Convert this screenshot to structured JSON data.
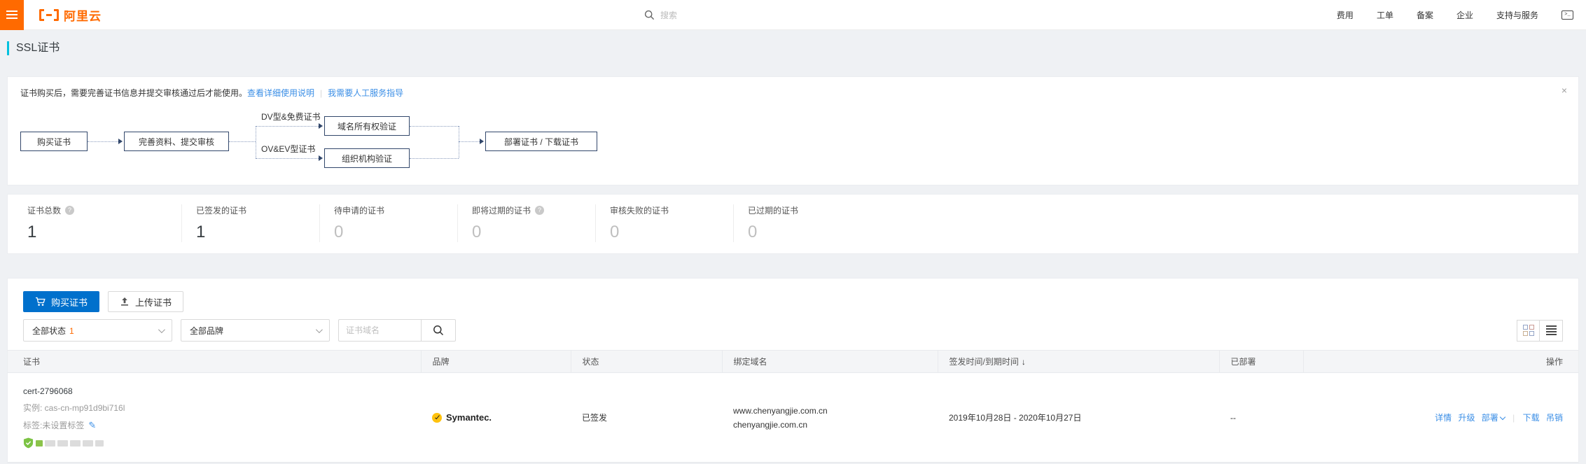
{
  "topnav": {
    "logo": "阿里云",
    "search_placeholder": "搜索",
    "menu": [
      "费用",
      "工单",
      "备案",
      "企业",
      "支持与服务"
    ]
  },
  "icons": {
    "help": "?",
    "close": "×",
    "sort_desc": "↓",
    "console": ">_"
  },
  "page_title": "SSL证书",
  "banner": {
    "text": "证书购买后，需要完善证书信息并提交审核通过后才能使用。",
    "link_docs": "查看详细使用说明",
    "separator": "|",
    "link_support": "我需要人工服务指导"
  },
  "flow": {
    "buy": "购买证书",
    "complete": "完善资料、提交审核",
    "dv_label": "DV型&免费证书",
    "ovev_label": "OV&EV型证书",
    "domain_verify": "域名所有权验证",
    "org_verify": "组织机构验证",
    "deploy": "部署证书 / 下载证书"
  },
  "stats": [
    {
      "label": "证书总数",
      "value": "1"
    },
    {
      "label": "已签发的证书",
      "value": "1"
    },
    {
      "label": "待申请的证书",
      "value": "0"
    },
    {
      "label": "即将过期的证书",
      "value": "0"
    },
    {
      "label": "审核失败的证书",
      "value": "0"
    },
    {
      "label": "已过期的证书",
      "value": "0"
    }
  ],
  "toolbar": {
    "buy": "购买证书",
    "upload": "上传证书",
    "status_filter": "全部状态",
    "status_count": "1",
    "brand_filter": "全部品牌",
    "domain_placeholder": "证书域名"
  },
  "table": {
    "headers": {
      "cert": "证书",
      "brand": "品牌",
      "status": "状态",
      "domain": "绑定域名",
      "dates": "签发时间/到期时间",
      "deployed": "已部署",
      "actions": "操作"
    },
    "row": {
      "id": "cert-2796068",
      "instance": "实例: cas-cn-mp91d9bi716l",
      "tag": "标签:未设置标签",
      "brand": "Symantec.",
      "status": "已签发",
      "domain1": "www.chenyangjie.com.cn",
      "domain2": "chenyangjie.com.cn",
      "dates": "2019年10月28日 - 2020年10月27日",
      "deployed": "--",
      "actions": {
        "detail": "详情",
        "upgrade": "升级",
        "deploy": "部署",
        "download": "下载",
        "revoke": "吊销"
      }
    }
  },
  "colors": {
    "brand_orange": "#FF6A00",
    "primary_blue": "#0070CC",
    "link_blue": "#3A8EE6",
    "accent_cyan": "#00C1DE"
  }
}
